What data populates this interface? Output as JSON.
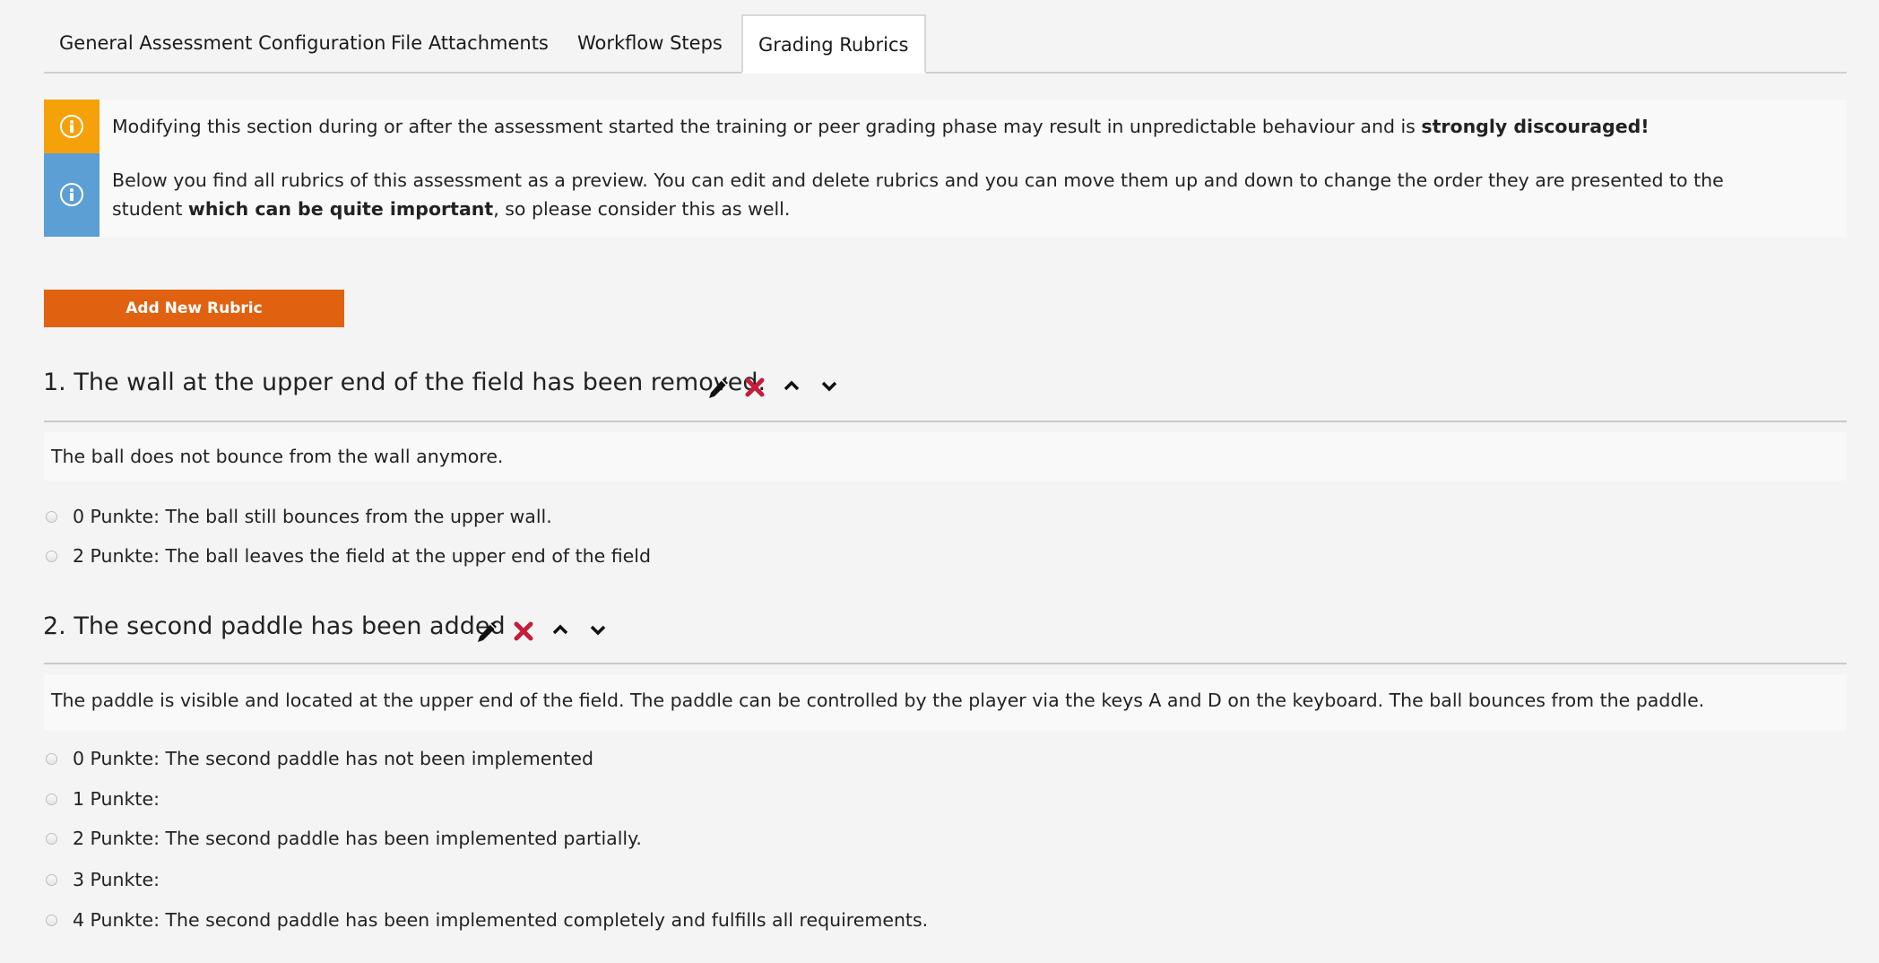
{
  "tabs": [
    {
      "label": "General Assessment Configuration"
    },
    {
      "label": "File Attachments"
    },
    {
      "label": "Workflow Steps"
    },
    {
      "label": "Grading Rubrics"
    }
  ],
  "notices": {
    "warning": {
      "text": "Modifying this section during or after the assessment started the training or peer grading phase may result in unpredictable behaviour and is ",
      "bold": "strongly discouraged!"
    },
    "info": {
      "text": "Below you find all rubrics of this assessment as a preview. You can edit and delete rubrics and you can move them up and down to change the order they are presented to the student ",
      "bold": "which can be quite important",
      "tail": ", so please consider this as well."
    }
  },
  "add_button": {
    "label": "Add New Rubric"
  },
  "rubrics": [
    {
      "title": "1. The wall at the upper end of the field has been removed.",
      "description": "The ball does not bounce from the wall anymore.",
      "options": [
        "0 Punkte: The ball still bounces from the upper wall.",
        "2 Punkte: The ball leaves the field at the upper end of the field"
      ]
    },
    {
      "title": "2. The second paddle has been added",
      "description": "The paddle is visible and located at the upper end of the field. The paddle can be controlled by the player via the keys A and D on the keyboard. The ball bounces from the paddle.",
      "options": [
        "0 Punkte: The second paddle has not been implemented",
        "1 Punkte:",
        "2 Punkte: The second paddle has been implemented partially.",
        "3 Punkte:",
        "4 Punkte: The second paddle has been implemented completely and fulfills all requirements."
      ]
    }
  ],
  "icons": {
    "edit": "pencil-icon",
    "delete": "delete-x-icon",
    "up": "chevron-up-icon",
    "down": "chevron-down-icon",
    "delete_color": "#c41e3a",
    "warning_color": "#f4a10a",
    "info_color": "#5b9fd4",
    "button_color": "#e06211"
  }
}
